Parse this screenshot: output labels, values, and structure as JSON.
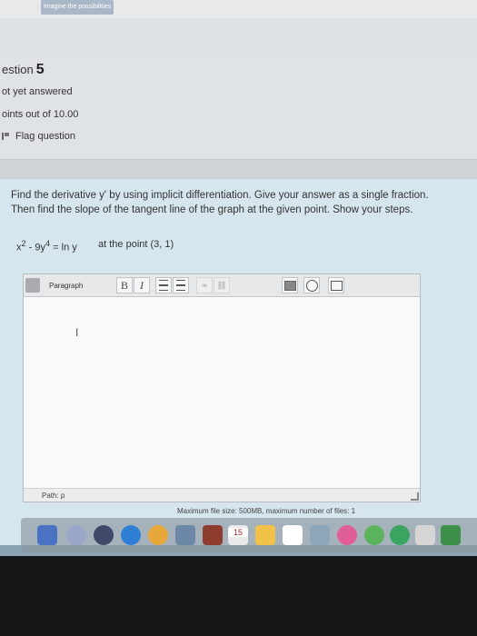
{
  "banner": {
    "text": "Imagine the possibilities"
  },
  "info": {
    "question_label": "estion",
    "question_number": "5",
    "status": "ot yet answered",
    "points": "oints out of 10.00",
    "flag_label": "Flag question"
  },
  "question": {
    "prompt": "Find the derivative y' by using implicit differentiation. Give your answer as a single fraction. Then find the slope of the tangent line of the graph at the given point. Show your steps.",
    "equation_lhs": "x",
    "eq_exp1": "2",
    "equation_mid": " - 9y",
    "eq_exp2": "4",
    "equation_rhs": " = ln y",
    "point_text": "at the point (3, 1)"
  },
  "editor": {
    "format_select": "Paragraph",
    "bold": "B",
    "italic": "I",
    "cursor": "I",
    "path": "Path: p"
  },
  "footer": {
    "max_file": "Maximum file size: 500MB, maximum number of files: 1"
  },
  "dock": {
    "calendar_day": "15"
  },
  "colors": {
    "question_bg": "#d6e6ee",
    "info_bg": "#dfe3e6"
  }
}
